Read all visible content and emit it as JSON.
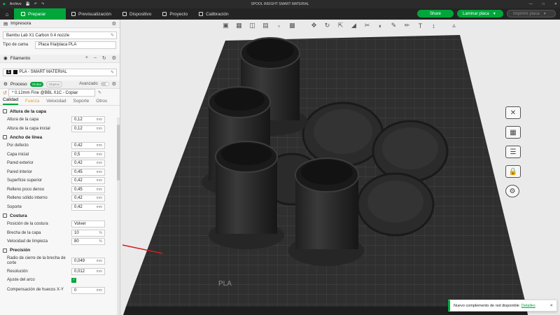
{
  "titlebar": {
    "menu_label": "Archivo",
    "title": "SPOOL WEIGHT SMART MATERIAL"
  },
  "tabs": [
    {
      "label": "Preparar"
    },
    {
      "label": "Previsualización"
    },
    {
      "label": "Dispositivo"
    },
    {
      "label": "Proyecto"
    },
    {
      "label": "Calibración"
    }
  ],
  "actions": {
    "share": "Share",
    "slice": "Laminar placa",
    "print": "Imprimir placa"
  },
  "printer": {
    "header": "Impresora",
    "model": "Bambu Lab X1 Carbon 0.4 nozzle",
    "bed_label": "Tipo de cama",
    "bed_value": "Placa fría/placa PLA"
  },
  "filament": {
    "header": "Filamento",
    "index": "1",
    "name": "PLA - SMART MATERIAL"
  },
  "process": {
    "header": "Proceso",
    "badge_global": "Global",
    "badge_objects": "Objetos",
    "advanced_label": "Avanzado",
    "profile": "* 0.12mm Fine @BBL X1C - Copiar"
  },
  "subtabs": [
    "Calidad",
    "Fuerza",
    "Velocidad",
    "Soporte",
    "Otros"
  ],
  "groups": {
    "layer_height": {
      "title": "Altura de la capa",
      "rows": [
        {
          "label": "Altura de la capa",
          "value": "0,12",
          "unit": "mm"
        },
        {
          "label": "Altura de la capa inicial",
          "value": "0,12",
          "unit": "mm"
        }
      ]
    },
    "line_width": {
      "title": "Ancho de línea",
      "rows": [
        {
          "label": "Por defecto",
          "value": "0,42",
          "unit": "mm"
        },
        {
          "label": "Capa inicial",
          "value": "0,5",
          "unit": "mm"
        },
        {
          "label": "Pared exterior",
          "value": "0,42",
          "unit": "mm"
        },
        {
          "label": "Pared interior",
          "value": "0,45",
          "unit": "mm"
        },
        {
          "label": "Superficie superior",
          "value": "0,42",
          "unit": "mm"
        },
        {
          "label": "Relleno poco denso",
          "value": "0,45",
          "unit": "mm"
        },
        {
          "label": "Relleno sólido interno",
          "value": "0,42",
          "unit": "mm"
        },
        {
          "label": "Soporte",
          "value": "0,42",
          "unit": "mm"
        }
      ]
    },
    "seam": {
      "title": "Costura",
      "rows": [
        {
          "label": "Posición de la costura",
          "value": "Volver",
          "unit": ""
        },
        {
          "label": "Brecha de la capa",
          "value": "10",
          "unit": "%"
        },
        {
          "label": "Velocidad de limpieza",
          "value": "80",
          "unit": "%"
        }
      ]
    },
    "precision": {
      "title": "Precisión",
      "rows": [
        {
          "label": "Radio de cierre de la brecha de corte",
          "value": "0,049",
          "unit": "mm"
        },
        {
          "label": "Resolución",
          "value": "0,012",
          "unit": "mm"
        },
        {
          "label": "Ajuste del arco",
          "value": "",
          "unit": ""
        },
        {
          "label": "Compensación de huecos X-Y",
          "value": "0",
          "unit": "mm"
        }
      ]
    }
  },
  "plate_label": "PLA",
  "toast": {
    "message": "Nuevo complemento de red disponible",
    "link": "Detalles"
  }
}
